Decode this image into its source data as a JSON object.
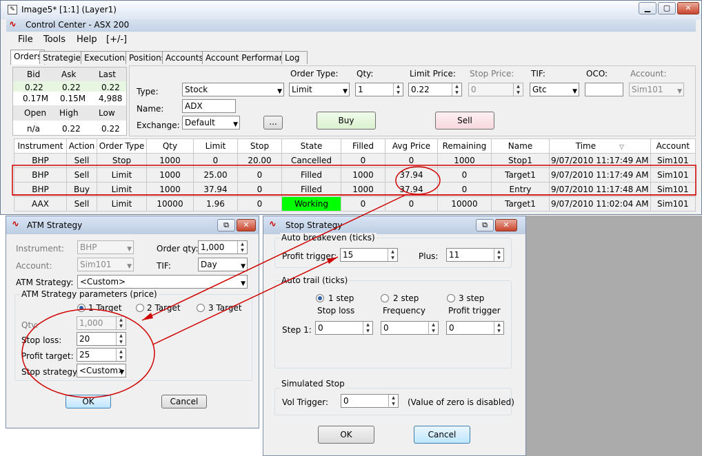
{
  "app": {
    "title": "Image5* [1:1] (Layer1)",
    "subtitle": "Control Center - ASX 200"
  },
  "menu": [
    "File",
    "Tools",
    "Help",
    "[+/-]"
  ],
  "tabs": [
    "Orders",
    "Strategies",
    "Executions",
    "Positions",
    "Accounts",
    "Account Performance",
    "Log"
  ],
  "quote": {
    "headers": [
      "Bid",
      "Ask",
      "Last"
    ],
    "prices": [
      "0.22",
      "0.22",
      "0.22"
    ],
    "sizes": [
      "0.17M",
      "0.15M",
      "4,988"
    ],
    "headers2": [
      "Open",
      "High",
      "Low"
    ],
    "vals2": [
      "n/a",
      "0.22",
      "0.22"
    ]
  },
  "entry": {
    "type_label": "Type:",
    "type_value": "Stock",
    "name_label": "Name:",
    "name_value": "ADX",
    "exchange_label": "Exchange:",
    "exchange_value": "Default",
    "dots": "...",
    "ordertype_label": "Order Type:",
    "ordertype_value": "Limit",
    "qty_label": "Qty:",
    "qty_value": "1",
    "limit_label": "Limit Price:",
    "limit_value": "0.22",
    "stop_label": "Stop Price:",
    "stop_value": "0",
    "tif_label": "TIF:",
    "tif_value": "Gtc",
    "oco_label": "OCO:",
    "oco_value": "",
    "account_label": "Account:",
    "account_value": "Sim101",
    "buy": "Buy",
    "sell": "Sell"
  },
  "orders": {
    "columns": [
      "Instrument",
      "Action",
      "Order Type",
      "Qty",
      "Limit",
      "Stop",
      "State",
      "Filled",
      "Avg Price",
      "Remaining",
      "Name",
      "Time",
      "Account"
    ],
    "rows": [
      [
        "BHP",
        "Sell",
        "Stop",
        "1000",
        "0",
        "20.00",
        "Cancelled",
        "0",
        "0",
        "1000",
        "Stop1",
        "9/07/2010 11:17:49 AM",
        "Sim101"
      ],
      [
        "BHP",
        "Sell",
        "Limit",
        "1000",
        "25.00",
        "0",
        "Filled",
        "1000",
        "37.94",
        "0",
        "Target1",
        "9/07/2010 11:17:49 AM",
        "Sim101"
      ],
      [
        "BHP",
        "Buy",
        "Limit",
        "1000",
        "37.94",
        "0",
        "Filled",
        "1000",
        "37.94",
        "0",
        "Entry",
        "9/07/2010 11:17:48 AM",
        "Sim101"
      ],
      [
        "AAX",
        "Sell",
        "Limit",
        "10000",
        "1.96",
        "0",
        "Working",
        "0",
        "0",
        "10000",
        "Target1",
        "9/07/2010 11:02:04 AM",
        "Sim101"
      ]
    ]
  },
  "atm": {
    "title": "ATM Strategy",
    "instrument_label": "Instrument:",
    "instrument_value": "BHP",
    "orderqty_label": "Order qty:",
    "orderqty_value": "1,000",
    "account_label": "Account:",
    "account_value": "Sim101",
    "tif_label": "TIF:",
    "tif_value": "Day",
    "strategy_label": "ATM Strategy:",
    "strategy_value": "<Custom>",
    "params_label": "ATM Strategy parameters (price)",
    "radio1": "1 Target",
    "radio2": "2 Target",
    "radio3": "3 Target",
    "qty_label": "Qty:",
    "qty_value": "1,000",
    "stoploss_label": "Stop loss:",
    "stoploss_value": "20",
    "profit_label": "Profit target:",
    "profit_value": "25",
    "stopstrat_label": "Stop strategy:",
    "stopstrat_value": "<Custom>",
    "ok": "OK",
    "cancel": "Cancel"
  },
  "stop": {
    "title": "Stop Strategy",
    "auto_be": "Auto breakeven (ticks)",
    "profit_trigger_label": "Profit trigger:",
    "profit_trigger_value": "15",
    "plus_label": "Plus:",
    "plus_value": "11",
    "auto_trail": "Auto trail (ticks)",
    "r1": "1 step",
    "r2": "2 step",
    "r3": "3 step",
    "c1": "Stop loss",
    "c2": "Frequency",
    "c3": "Profit trigger",
    "step1_label": "Step 1:",
    "step1_a": "0",
    "step1_b": "0",
    "step1_c": "0",
    "simulated": "Simulated Stop",
    "vol_label": "Vol Trigger:",
    "vol_value": "0",
    "vol_note": "(Value of zero is disabled)",
    "ok": "OK",
    "cancel": "Cancel"
  },
  "colors": {
    "working": "#00ff00",
    "annotation": "#d00000"
  }
}
